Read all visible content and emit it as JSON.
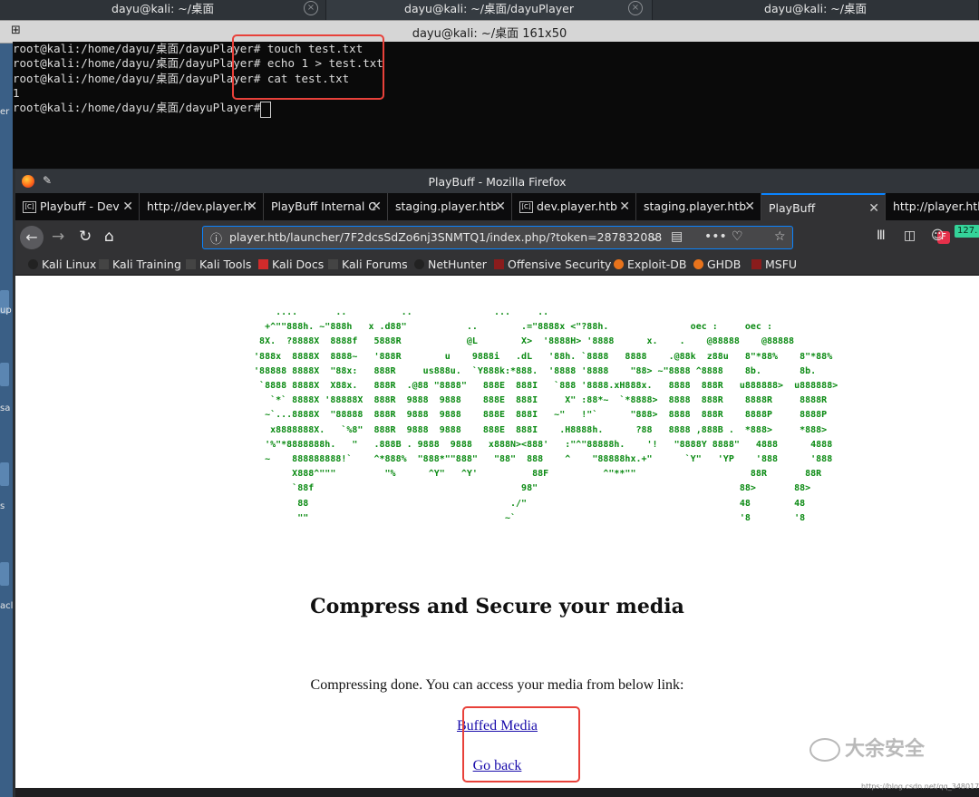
{
  "terminal": {
    "tabs": [
      {
        "label": "dayu@kali: ~/桌面",
        "closable": true
      },
      {
        "label": "dayu@kali: ~/桌面/dayuPlayer",
        "closable": true
      },
      {
        "label": "dayu@kali: ~/桌面",
        "closable": false
      }
    ],
    "window_title": "dayu@kali: ~/桌面 161x50",
    "lines": [
      "root@kali:/home/dayu/桌面/dayuPlayer# touch test.txt",
      "root@kali:/home/dayu/桌面/dayuPlayer# echo 1 > test.txt",
      "root@kali:/home/dayu/桌面/dayuPlayer# cat test.txt",
      "1",
      "root@kali:/home/dayu/桌面/dayuPlayer# "
    ]
  },
  "desktop": {
    "labels": [
      "lys",
      "er",
      "up",
      "sa",
      "s",
      "acl"
    ]
  },
  "firefox": {
    "window_title": "PlayBuff - Mozilla Firefox",
    "tabs": [
      {
        "label": "Playbuff - Dev",
        "favicon": "[C]"
      },
      {
        "label": "http://dev.player.h",
        "favicon": ""
      },
      {
        "label": "PlayBuff Internal C",
        "favicon": ""
      },
      {
        "label": "staging.player.htb",
        "favicon": ""
      },
      {
        "label": "dev.player.htb",
        "favicon": "[C]"
      },
      {
        "label": "staging.player.htb",
        "favicon": ""
      },
      {
        "label": "PlayBuff",
        "favicon": "",
        "active": true
      },
      {
        "label": "http://player.htb",
        "favicon": ""
      }
    ],
    "url": "player.htb/launcher/7F2dcsSdZo6nj3SNMTQ1/index.php/?token=287832088",
    "badge": "127.",
    "bookmarks": [
      "Kali Linux",
      "Kali Training",
      "Kali Tools",
      "Kali Docs",
      "Kali Forums",
      "NetHunter",
      "Offensive Security",
      "Exploit-DB",
      "GHDB",
      "MSFU"
    ],
    "colors": {
      "accent": "#0a84ff",
      "chrome": "#323234",
      "link": "#1a0dab",
      "ascii_art": "#0a8a12",
      "highlight_box": "#e8413a"
    }
  },
  "page": {
    "ascii_art": "      ....       ..          ..               ...     ..\n    +^\"\"888h. ~\"888h   x .d88\"           ..        .=\"8888x <\"?88h.               oec :     oec :\n   8X.  ?8888X  8888f   5888R            @L        X>  '8888H> '8888      x.    .    @88888    @88888\n  '888x  8888X  8888~   '888R        u    9888i   .dL   '88h. `8888   8888    .@88k  z88u   8\"*88%    8\"*88%\n  '88888 8888X  \"88x:   888R     us888u.  `Y888k:*888.  '8888 '8888    \"88> ~\"8888 ^8888    8b.       8b.\n   `8888 8888X  X88x.   888R  .@88 \"8888\"   888E  888I   `888 '8888.xH888x.   8888  888R   u888888>  u888888>\n     `*` 8888X '88888X  888R  9888  9888    888E  888I     X\" :88*~  `*8888>  8888  888R    8888R     8888R\n    ~`...8888X  \"88888  888R  9888  9888    888E  888I   ~\"   !\"`      \"888>  8888  888R    8888P     8888P\n     x8888888X.   `%8\"  888R  9888  9888    888E  888I    .H8888h.      ?88   8888 ,888B .  *888>     *888>\n    '%\"*8888888h.   \"   .888B . 9888  9888   x888N><888'   :\"^\"88888h.    '!   \"8888Y 8888\"   4888      4888\n    ~    888888888!`    ^*888%  \"888*\"\"888\"   \"88\"  888    ^    \"88888hx.+\"      `Y\"   'YP    '888      '888\n         X888^\"\"\"         \"%      ^Y\"   ^Y'          88F          ^\"**\"\"                     88R       88R\n         `88f                                      98\"                                     88>       88>\n          88                                     ./\"                                       48        48\n          \"\"                                    ~`                                         '8        '8",
    "headline": "Compress and Secure your media",
    "message": "Compressing done. You can access your media from below link:",
    "link_media": "Buffed Media",
    "link_back": "Go back"
  },
  "watermark": {
    "text": "大余安全",
    "caption": "https://blog.csdn.net/qq_34801745"
  }
}
